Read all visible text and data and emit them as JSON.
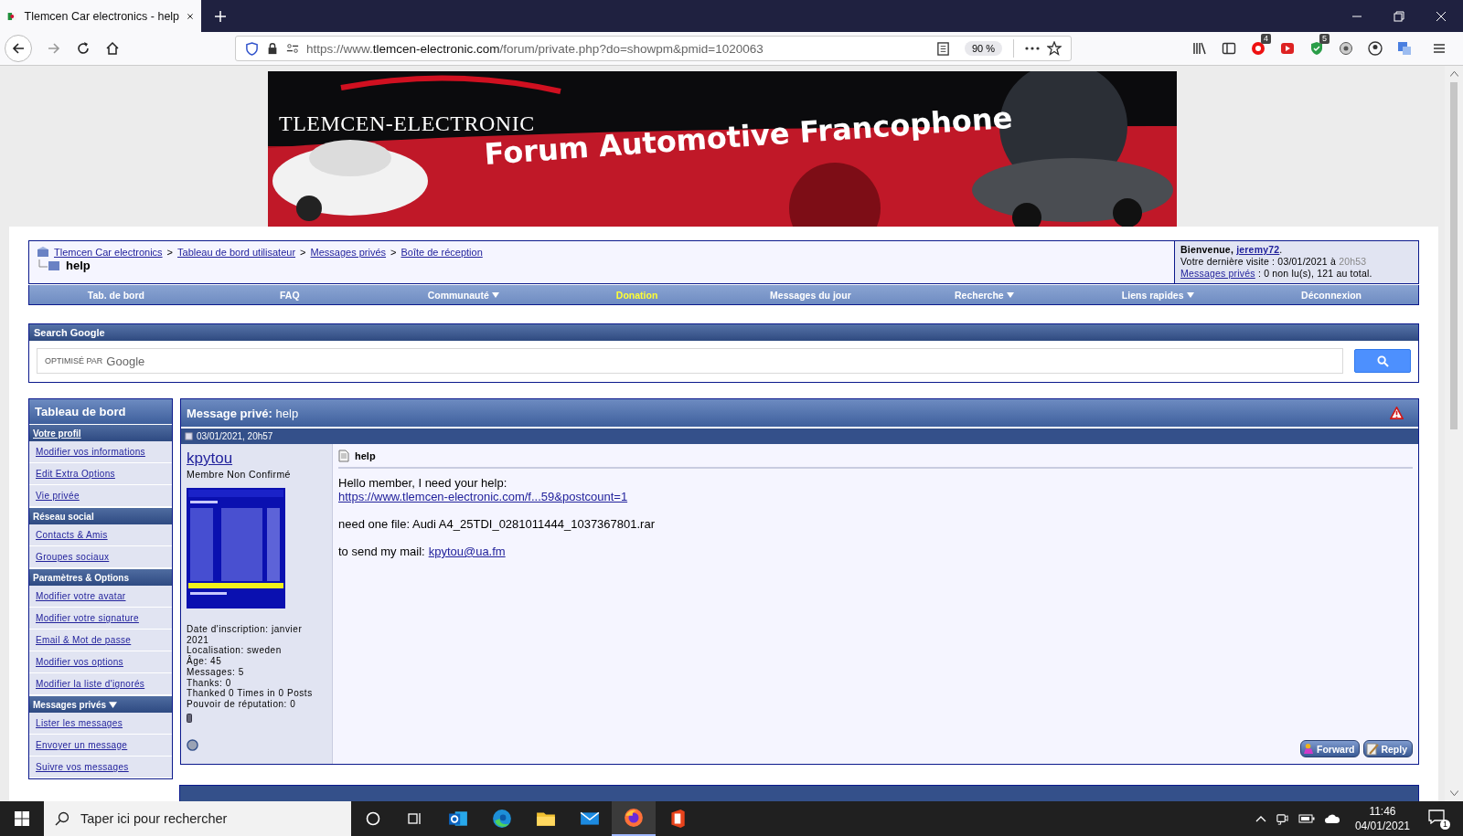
{
  "browser": {
    "tab": {
      "title": "Tlemcen Car electronics - help",
      "selected": true
    },
    "url": {
      "prefix": "https://www.",
      "domain": "tlemcen-electronic.com",
      "path": "/forum/private.php?do=showpm&pmid=1020063"
    },
    "zoom": "90 %",
    "badges": [
      "4",
      "5"
    ]
  },
  "banner": {
    "logo": "TLEMCEN-ELECTRONIC",
    "tagline": "Forum Automotive Francophone"
  },
  "breadcrumb": {
    "trail": [
      {
        "kind": "link",
        "text": "Tlemcen Car electronics"
      },
      {
        "kind": "sep",
        "text": ">"
      },
      {
        "kind": "link",
        "text": "Tableau de bord utilisateur"
      },
      {
        "kind": "sep",
        "text": ">"
      },
      {
        "kind": "link",
        "text": "Messages privés"
      },
      {
        "kind": "sep",
        "text": ">"
      },
      {
        "kind": "link",
        "text": "Boîte de réception"
      }
    ],
    "current": "help"
  },
  "welcome": {
    "greeting": "Bienvenue,",
    "user": "jeremy72",
    "end": ".",
    "last_visit": "Votre dernière visite : 03/01/2021 à",
    "last_visit_time": "20h53",
    "pm_link": "Messages privés",
    "pm_status": ": 0 non lu(s), 121 au total."
  },
  "nav": [
    {
      "label": "Tab. de bord",
      "dropdown": false,
      "highlighted": false
    },
    {
      "label": "FAQ",
      "dropdown": false,
      "highlighted": false
    },
    {
      "label": "Communauté",
      "dropdown": true,
      "highlighted": false
    },
    {
      "label": "Donation",
      "dropdown": false,
      "highlighted": true
    },
    {
      "label": "Messages du jour",
      "dropdown": false,
      "highlighted": false
    },
    {
      "label": "Recherche",
      "dropdown": true,
      "highlighted": false
    },
    {
      "label": "Liens rapides",
      "dropdown": true,
      "highlighted": false
    },
    {
      "label": "Déconnexion",
      "dropdown": false,
      "highlighted": false
    }
  ],
  "search": {
    "title": "Search Google",
    "powered": "OPTIMISÉ PAR",
    "brand": "Google"
  },
  "sidebar": {
    "title": "Tableau de bord",
    "sections": [
      {
        "title": "Votre profil",
        "link": true,
        "dropdown": false,
        "items": [
          "Modifier vos informations",
          "Edit Extra Options",
          "Vie privée"
        ]
      },
      {
        "title": "Réseau social",
        "link": false,
        "dropdown": false,
        "items": [
          "Contacts & Amis",
          "Groupes sociaux"
        ]
      },
      {
        "title": "Paramètres & Options",
        "link": false,
        "dropdown": false,
        "items": [
          "Modifier votre avatar",
          "Modifier votre signature",
          "Email & Mot de passe",
          "Modifier vos options",
          "Modifier la liste d'ignorés"
        ]
      },
      {
        "title": "Messages privés",
        "link": false,
        "dropdown": true,
        "items": [
          "Lister les messages",
          "Envoyer un message",
          "Suivre vos messages"
        ]
      }
    ]
  },
  "message": {
    "heading": "**Message privé:** help",
    "date": "03/01/2021, 20h57",
    "author": {
      "name": "kpytou",
      "rank": "Membre Non Confirmé",
      "online": false,
      "info": [
        "Date d'inscription: janvier 2021",
        "Localisation: sweden",
        "Âge: 45",
        "Messages: 5",
        "Thanks: 0",
        "Thanked 0 Times in 0 Posts",
        "Pouvoir de réputation: 0"
      ]
    },
    "title": "help",
    "paragraphs": [
      [
        [
          {
            "kind": "text",
            "text": "Hello member, I need your help:"
          }
        ],
        [
          {
            "kind": "link",
            "text": "https://www.tlemcen-electronic.com/f...59&postcount=1"
          }
        ]
      ],
      [
        [
          {
            "kind": "text",
            "text": "need one file: Audi A4_25TDI_0281011444_1037367801.rar"
          }
        ]
      ],
      [
        [
          {
            "kind": "text",
            "text": "to send my mail:"
          },
          {
            "kind": "link",
            "text": "kpytou@ua.fm"
          }
        ]
      ]
    ],
    "buttons": [
      {
        "kind": "forward",
        "label": "Forward"
      },
      {
        "kind": "reply",
        "label": "Reply"
      }
    ]
  },
  "taskbar": {
    "search_placeholder": "Taper ici pour rechercher",
    "time": "11:46",
    "date": "04/01/2021",
    "notifications": "1",
    "apps": [
      {
        "kind": "outlook",
        "selected": false
      },
      {
        "kind": "edge",
        "selected": false
      },
      {
        "kind": "explorer",
        "selected": false
      },
      {
        "kind": "mail",
        "selected": false
      },
      {
        "kind": "firefox",
        "selected": true
      },
      {
        "kind": "office",
        "selected": false
      }
    ]
  }
}
